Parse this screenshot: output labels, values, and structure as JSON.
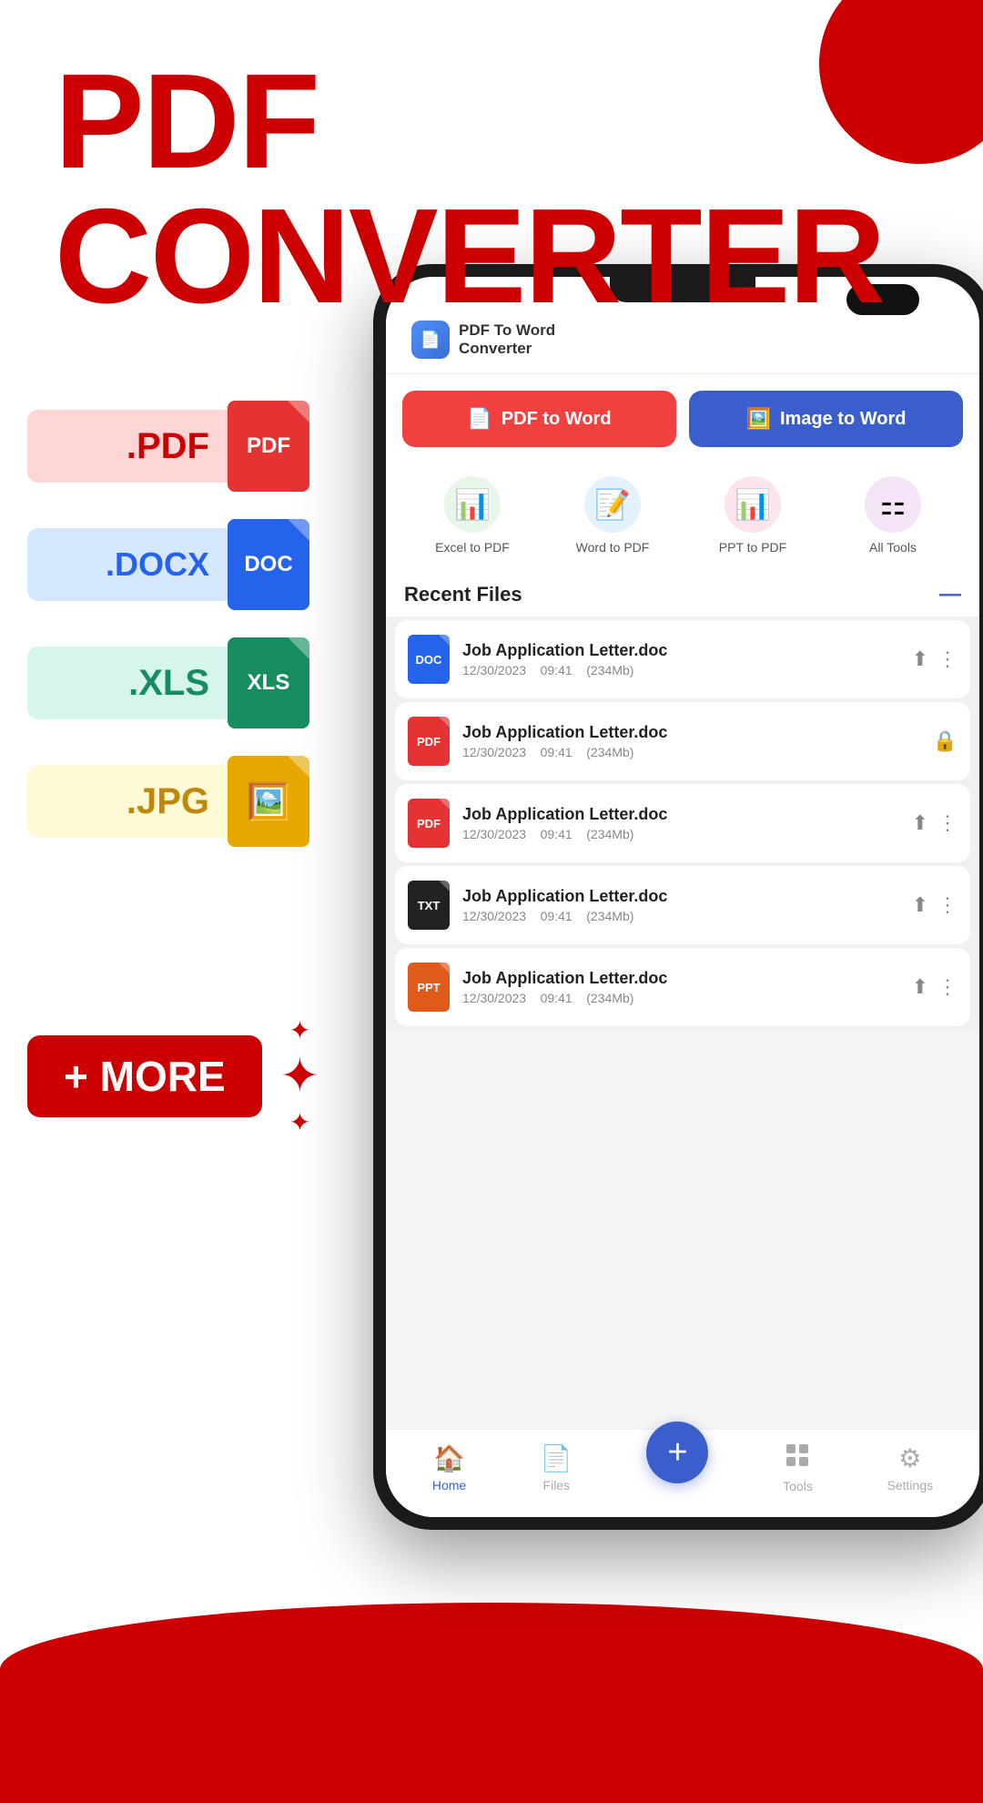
{
  "title": {
    "line1": "PDF",
    "line2": "CONVERTER"
  },
  "topShape": {
    "color": "#cc0000"
  },
  "fileTypes": [
    {
      "ext": ".PDF",
      "label": "PDF",
      "pillClass": "pill-pdf",
      "iconClass": "icon-pdf"
    },
    {
      "ext": ".DOCX",
      "label": "DOC",
      "pillClass": "pill-docx",
      "iconClass": "icon-doc"
    },
    {
      "ext": ".XLS",
      "label": "XLS",
      "pillClass": "pill-xls",
      "iconClass": "icon-xls"
    },
    {
      "ext": ".JPG",
      "label": "🖼",
      "pillClass": "pill-jpg",
      "iconClass": "icon-jpg"
    }
  ],
  "moreButton": {
    "label": "+ MORE"
  },
  "app": {
    "logo": {
      "text_line1": "PDF To Word",
      "text_line2": "Converter"
    },
    "buttons": [
      {
        "label": "PDF to Word",
        "type": "pdf"
      },
      {
        "label": "Image to Word",
        "type": "img"
      }
    ],
    "tools": [
      {
        "label": "Excel to PDF",
        "type": "xls"
      },
      {
        "label": "Word to PDF",
        "type": "doc"
      },
      {
        "label": "PPT to PDF",
        "type": "ppt"
      },
      {
        "label": "All Tools",
        "type": "all"
      }
    ],
    "recentFiles": {
      "title": "Recent Files",
      "files": [
        {
          "name": "Job Application Letter.doc",
          "date": "12/30/2023",
          "time": "09:41",
          "size": "234Mb",
          "type": "doc",
          "actions": "share-more"
        },
        {
          "name": "Job Application Letter.doc",
          "date": "12/30/2023",
          "time": "09:41",
          "size": "234Mb",
          "type": "pdf",
          "actions": "lock"
        },
        {
          "name": "Job Application Letter.doc",
          "date": "12/30/2023",
          "time": "09:41",
          "size": "234Mb",
          "type": "pdf",
          "actions": "share-more"
        },
        {
          "name": "Job Application Letter.doc",
          "date": "12/30/2023",
          "time": "09:41",
          "size": "234Mb",
          "type": "txt",
          "actions": "share-more"
        },
        {
          "name": "Job Application Letter.doc",
          "date": "12/30/2023",
          "time": "09:41",
          "size": "234Mb",
          "type": "ppt",
          "actions": "share-more"
        }
      ]
    },
    "bottomNav": [
      {
        "label": "Home",
        "icon": "🏠",
        "active": true
      },
      {
        "label": "Files",
        "icon": "📄",
        "active": false
      },
      {
        "label": "",
        "icon": "+",
        "fab": true
      },
      {
        "label": "Tools",
        "icon": "⚙",
        "active": false
      },
      {
        "label": "Settings",
        "icon": "⚙",
        "active": false
      }
    ]
  }
}
